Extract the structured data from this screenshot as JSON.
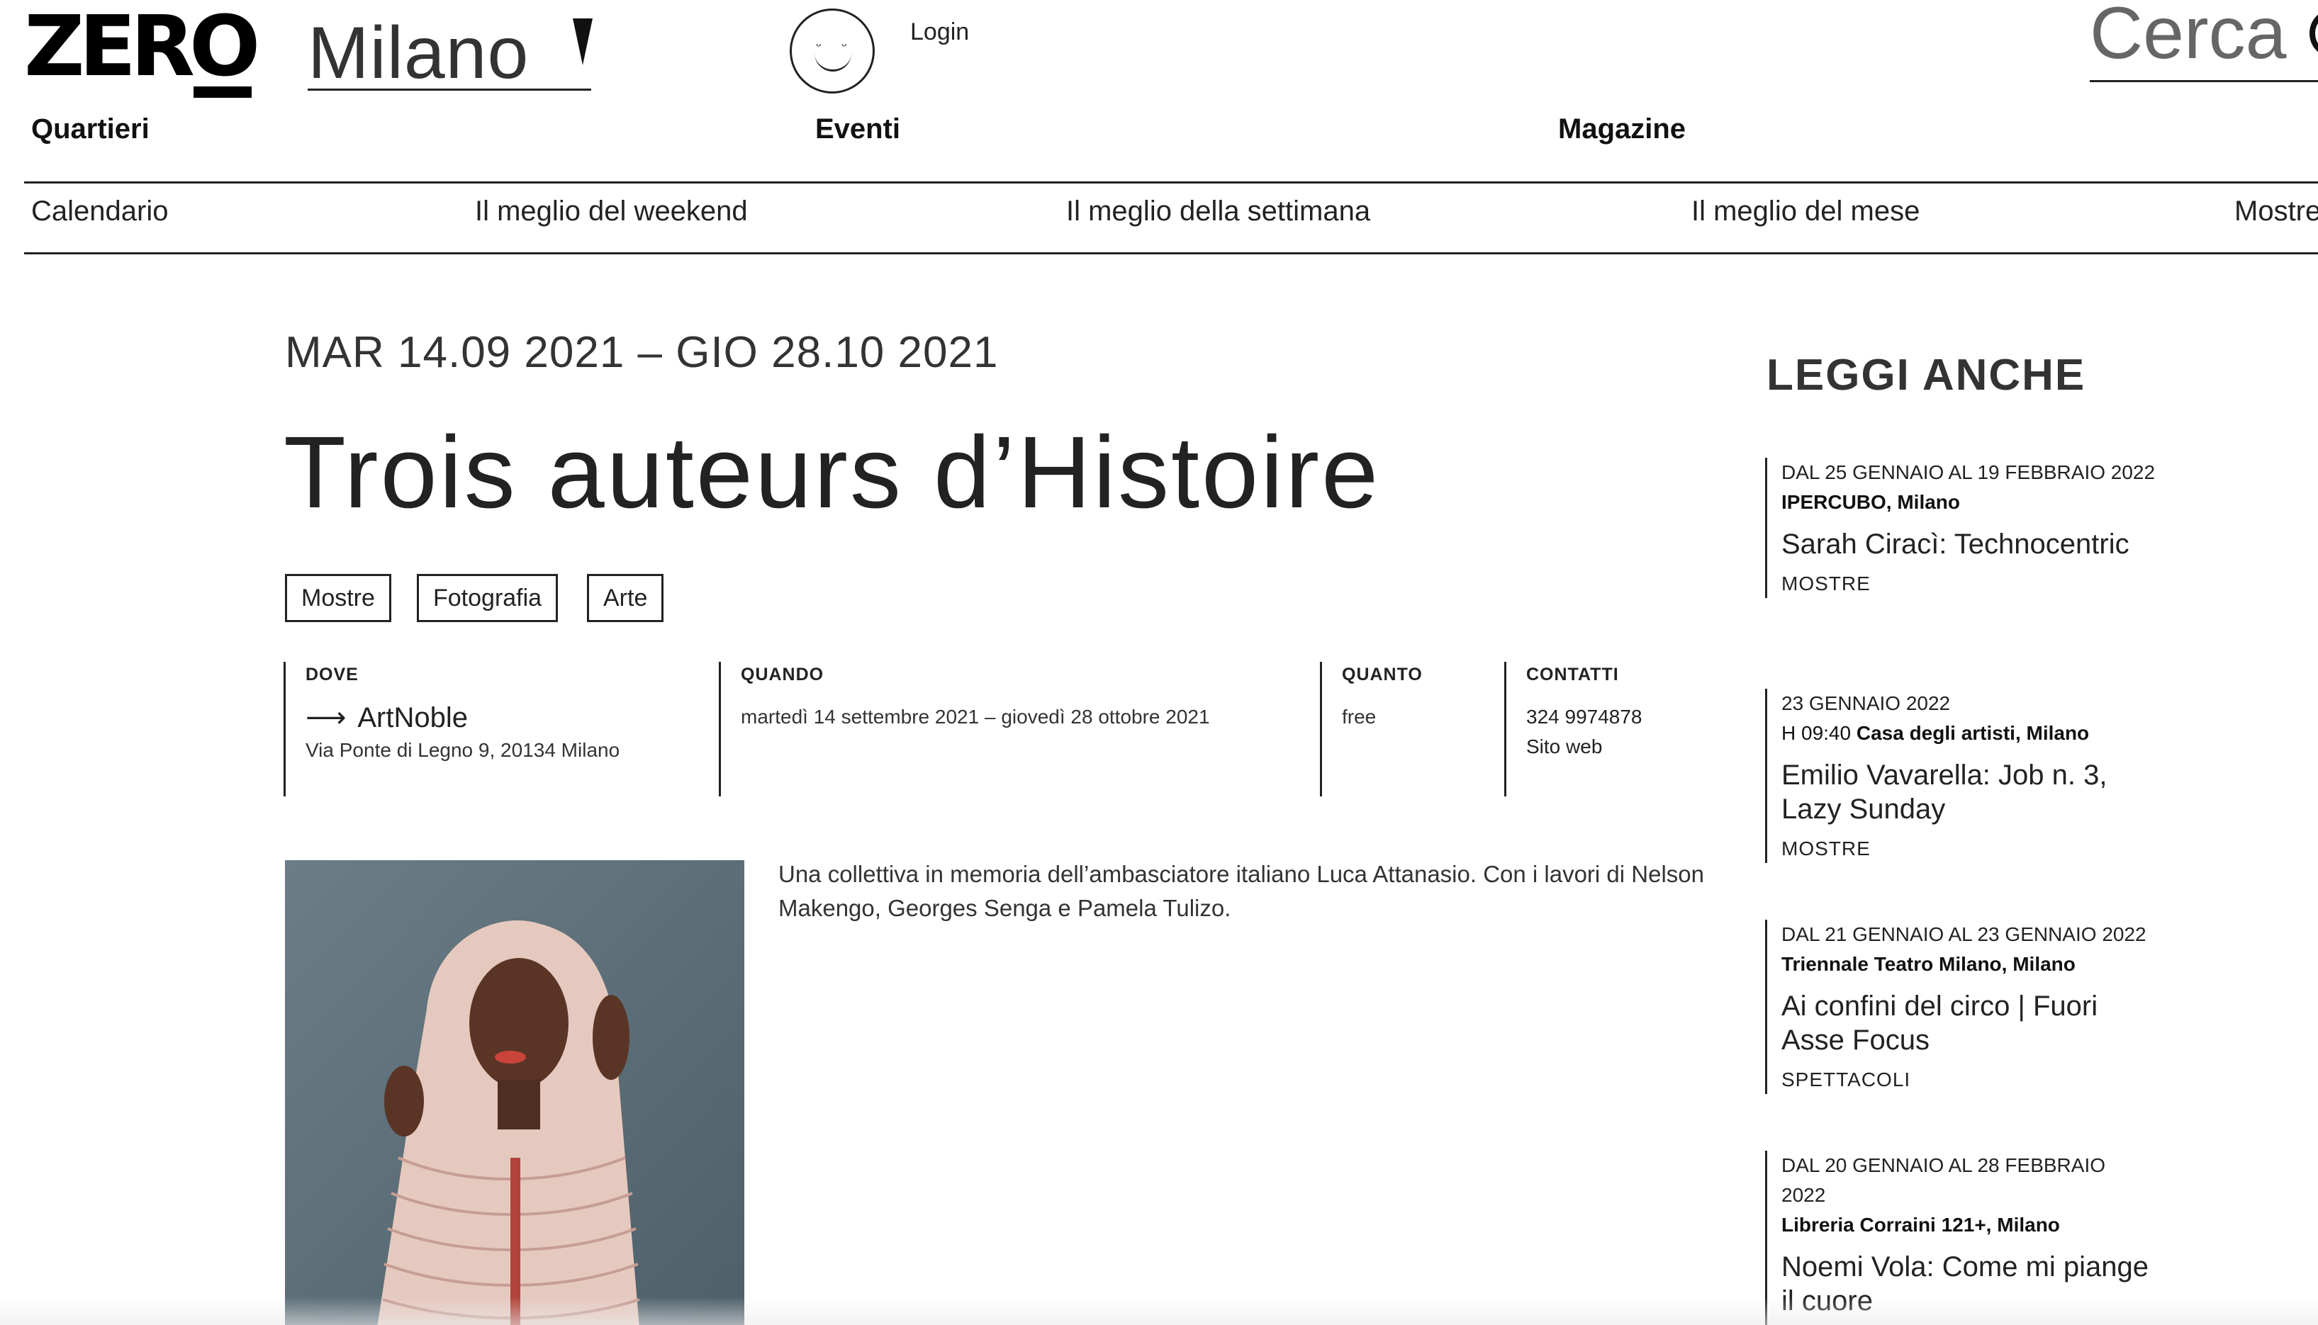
{
  "header": {
    "logo": "ZERO",
    "city": "Milano",
    "login": "Login",
    "search_placeholder": "Cerca"
  },
  "main_nav": [
    "Quartieri",
    "Eventi",
    "Magazine"
  ],
  "sub_nav": [
    "Calendario",
    "Il meglio del weekend",
    "Il meglio della settimana",
    "Il meglio del mese",
    "Mostre"
  ],
  "event": {
    "date_range": "MAR 14.09 2021 – GIO 28.10 2021",
    "title": "Trois auteurs d’Histoire",
    "tags": [
      "Mostre",
      "Fotografia",
      "Arte"
    ],
    "dove": {
      "heading": "DOVE",
      "venue": "ArtNoble",
      "address": "Via Ponte di Legno 9, 20134 Milano"
    },
    "quando": {
      "heading": "QUANDO",
      "value": "martedì 14 settembre 2021 – giovedì 28 ottobre 2021"
    },
    "quanto": {
      "heading": "QUANTO",
      "value": "free"
    },
    "contatti": {
      "heading": "CONTATTI",
      "phone": "324 9974878",
      "website": "Sito web"
    },
    "description": "Una collettiva in memoria dell’ambasciatore italiano Luca Attanasio. Con i lavori di Nelson Makengo, Georges Senga e Pamela Tulizo."
  },
  "sidebar": {
    "title": "LEGGI ANCHE",
    "cards": [
      {
        "date": "DAL 25 GENNAIO AL 19 FEBBRAIO 2022",
        "time": "",
        "place": "IPERCUBO, Milano",
        "title": "Sarah Ciracì: Technocentric",
        "category": "MOSTRE"
      },
      {
        "date": "23 GENNAIO 2022",
        "time": "H 09:40",
        "place": "Casa degli artisti, Milano",
        "title": "Emilio Vavarella: Job n. 3, Lazy Sunday",
        "category": "MOSTRE"
      },
      {
        "date": "DAL 21 GENNAIO AL 23 GENNAIO 2022",
        "time": "",
        "place": "Triennale Teatro Milano, Milano",
        "title": "Ai confini del circo | Fuori Asse Focus",
        "category": "SPETTACOLI"
      },
      {
        "date": "DAL 20 GENNAIO AL 28 FEBBRAIO 2022",
        "time": "",
        "place": "Libreria Corraini 121+, Milano",
        "title": "Noemi Vola: Come mi piange il cuore",
        "category": ""
      }
    ]
  }
}
